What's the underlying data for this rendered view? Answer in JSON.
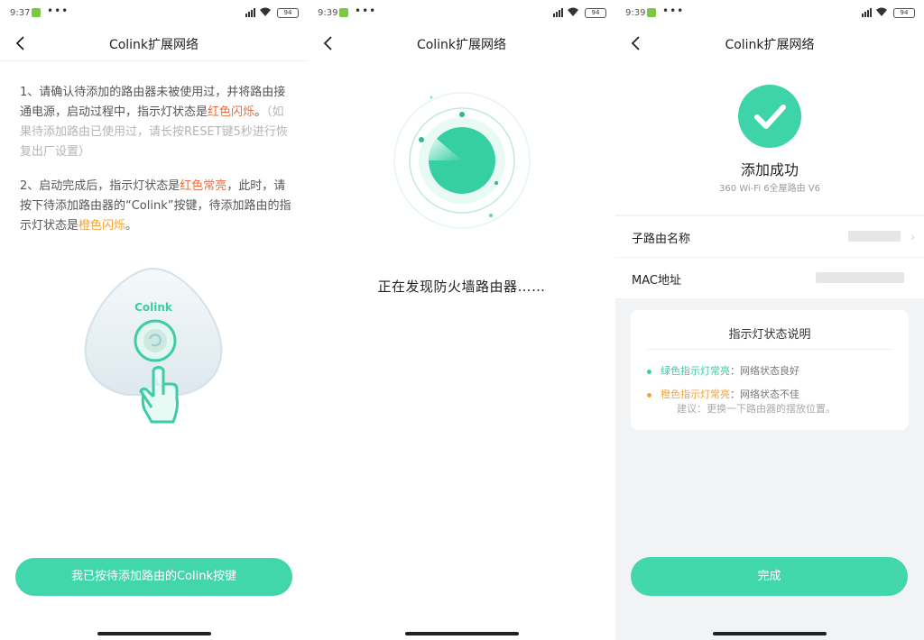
{
  "screens": [
    {
      "status_time": "9:37",
      "nav_title": "Colink扩展网络"
    },
    {
      "status_time": "9:39",
      "nav_title": "Colink扩展网络"
    },
    {
      "status_time": "9:39",
      "nav_title": "Colink扩展网络"
    }
  ],
  "status": {
    "dots": "•••",
    "battery": "94"
  },
  "screen1": {
    "p1_a": "1、请确认待添加的路由器未被使用过，并将路由接通电源，启动过程中，指示灯状态是",
    "p1_red": "红色闪烁",
    "p1_b": "。",
    "p1_grey": "（如果待添加路由已使用过，请长按RESET键5秒进行恢复出厂设置）",
    "p2_a": "2、启动完成后，指示灯状态是",
    "p2_red": "红色常亮",
    "p2_b": "，此时，请按下待添加路由器的“Colink”按键，待添加路由的指示灯状态是",
    "p2_orange": "橙色闪烁",
    "p2_c": "。",
    "device_label": "Colink",
    "button_label": "我已按待添加路由的Colink按键"
  },
  "screen2": {
    "scan_text": "正在发现防火墙路由器……"
  },
  "screen3": {
    "success_title": "添加成功",
    "success_sub": "360 Wi-Fi 6全屋路由 V6",
    "row_name_label": "子路由名称",
    "row_mac_label": "MAC地址",
    "card_title": "指示灯状态说明",
    "legend_green_key": "绿色指示灯常亮",
    "legend_green_val": "：网络状态良好",
    "legend_orange_key": "橙色指示灯常亮",
    "legend_orange_val": "：网络状态不佳",
    "legend_tip": "建议：更换一下路由器的摆放位置。",
    "done_label": "完成"
  },
  "colors": {
    "accent": "#42d6ad",
    "red": "#ef6c3a",
    "orange": "#f1a33c"
  }
}
